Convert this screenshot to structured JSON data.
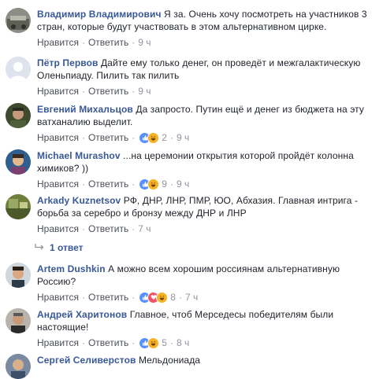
{
  "colors": {
    "link": "#385898",
    "text": "#1d2129",
    "muted": "#90949c",
    "like": "#5890ff",
    "love": "#f25268",
    "haha": "#f7b125"
  },
  "labels": {
    "like": "Нравится",
    "reply": "Ответить",
    "separator": "·"
  },
  "comments": [
    {
      "author": "Владимир Владимирович",
      "text": "Я за. Очень хочу посмотреть на участников 3 стран, которые будут участвовать в этом альтернативном цирке.",
      "reactions": [],
      "reaction_count": "",
      "time": "9 ч"
    },
    {
      "author": "Пётр Первов",
      "text": "Дайте ему только денег, он проведёт и межгалактическую Оленьпиаду. Пилить так пилить",
      "reactions": [],
      "reaction_count": "",
      "time": "9 ч"
    },
    {
      "author": "Евгений Михальцов",
      "text": "Да запросто. Путин ещё и денег из бюджета на эту ватханалию выделит.",
      "reactions": [
        "like",
        "haha"
      ],
      "reaction_count": "2",
      "time": "9 ч"
    },
    {
      "author": "Michael Murashov",
      "text": "...на церемонии открытия которой пройдёт колонна химиков? ))",
      "reactions": [
        "like",
        "haha"
      ],
      "reaction_count": "9",
      "time": "9 ч"
    },
    {
      "author": "Arkady Kuznetsov",
      "text": "РФ, ДНР, ЛНР, ПМР, ЮО, Абхазия. Главная интрига - борьба за серебро и бронзу между ДНР и ЛНР",
      "reactions": [],
      "reaction_count": "",
      "time": "7 ч"
    },
    {
      "author": "Artem Dushkin",
      "text": "А можно всем хорошим россиянам альтернативную Россию?",
      "reactions": [
        "like",
        "love",
        "haha"
      ],
      "reaction_count": "8",
      "time": "7 ч"
    },
    {
      "author": "Андрей Харитонов",
      "text": "Главное, чтоб Мерседесы победителям были настоящие!",
      "reactions": [
        "like",
        "haha"
      ],
      "reaction_count": "5",
      "time": "8 ч"
    },
    {
      "author": "Сергей Селиверстов",
      "text": "Мельдониада",
      "reactions": [],
      "reaction_count": "",
      "time": ""
    }
  ],
  "replies_link": "1 ответ"
}
